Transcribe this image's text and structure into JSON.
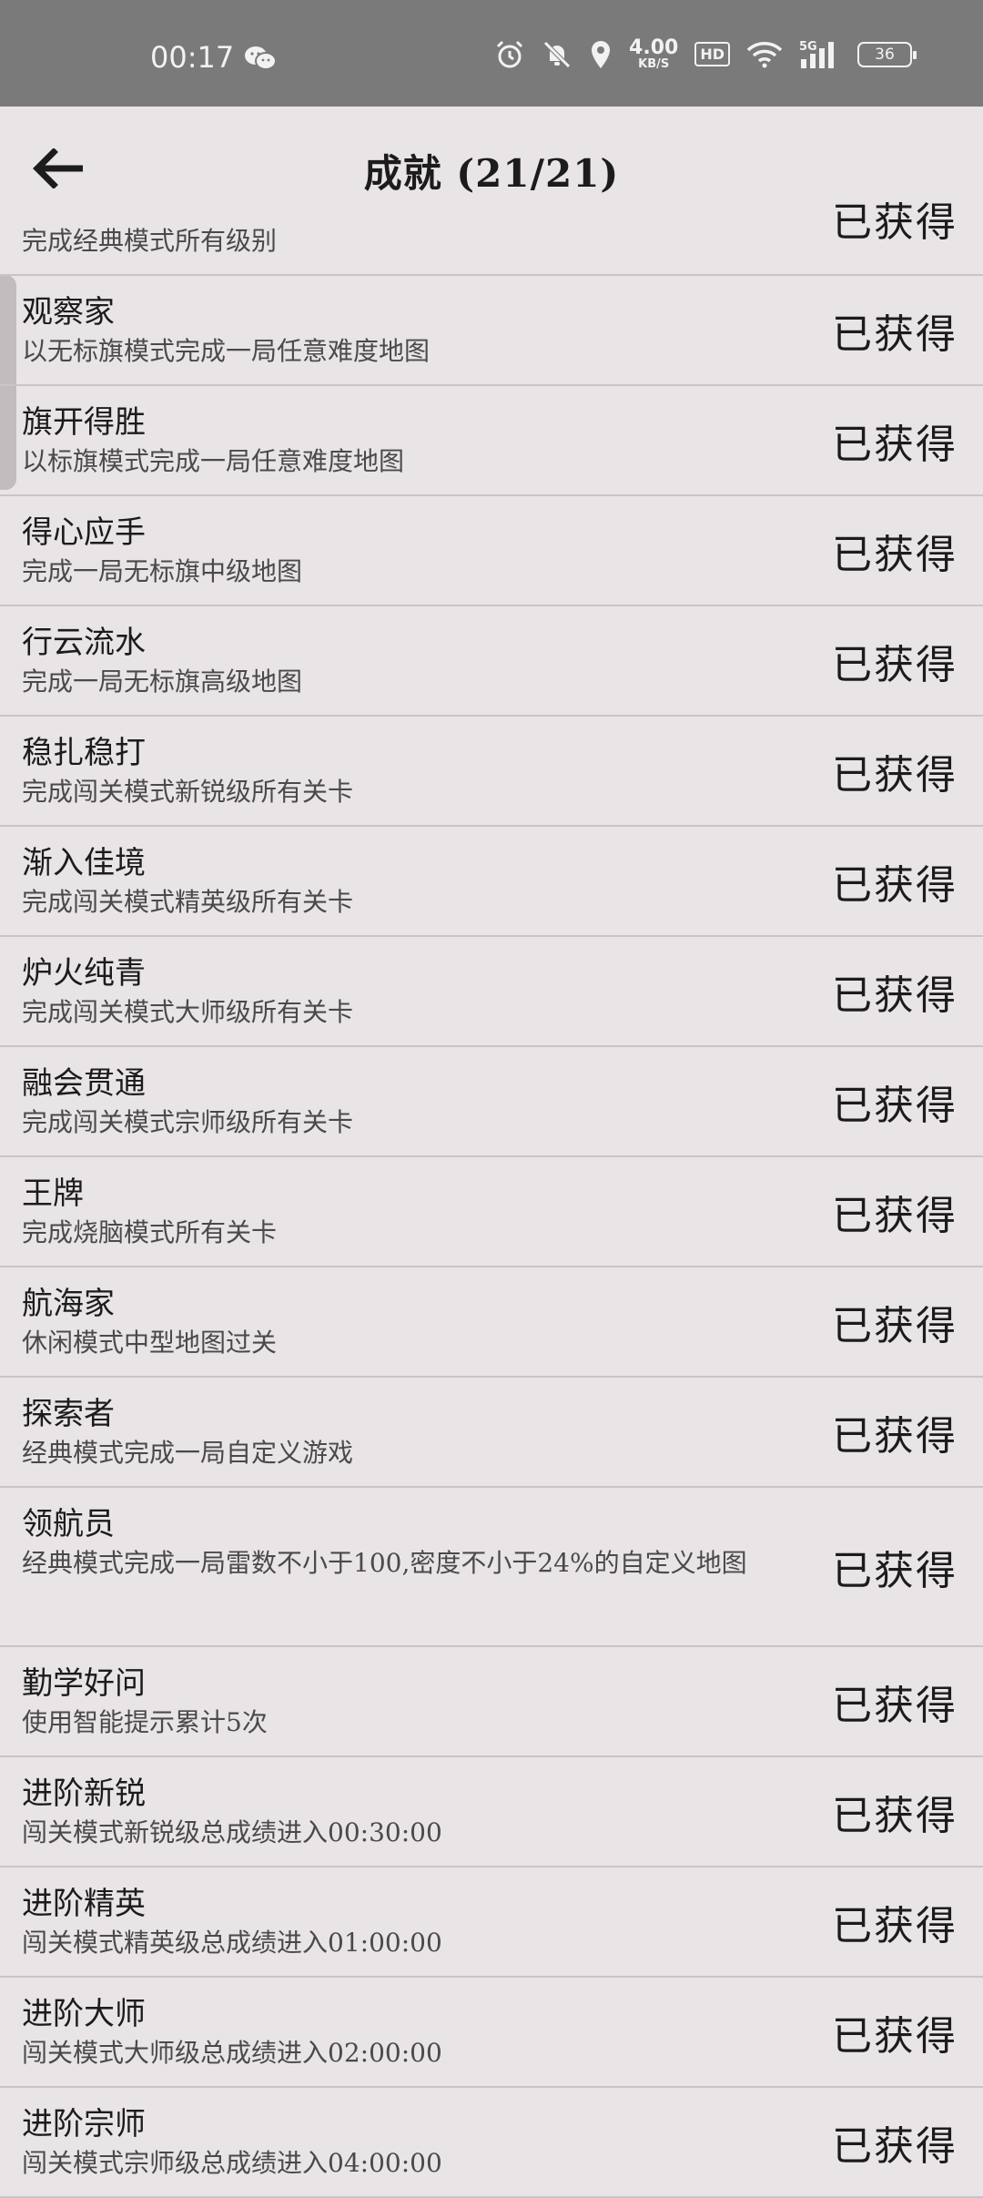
{
  "status_bar": {
    "time": "00:17",
    "net_speed_value": "4.00",
    "net_speed_unit": "KB/S",
    "hd_label": "HD",
    "signal_label": "5G",
    "battery": "36",
    "icons": [
      "wechat-icon",
      "alarm-icon",
      "mute-icon",
      "location-icon",
      "wifi-icon",
      "signal-icon",
      "battery-icon"
    ]
  },
  "header": {
    "title": "成就 (21/21)",
    "back_icon": "arrow-left-icon"
  },
  "achievements": [
    {
      "name": "",
      "desc": "完成经典模式所有级别",
      "status": "已获得"
    },
    {
      "name": "观察家",
      "desc": "以无标旗模式完成一局任意难度地图",
      "status": "已获得"
    },
    {
      "name": "旗开得胜",
      "desc": "以标旗模式完成一局任意难度地图",
      "status": "已获得"
    },
    {
      "name": "得心应手",
      "desc": "完成一局无标旗中级地图",
      "status": "已获得"
    },
    {
      "name": "行云流水",
      "desc": "完成一局无标旗高级地图",
      "status": "已获得"
    },
    {
      "name": "稳扎稳打",
      "desc": "完成闯关模式新锐级所有关卡",
      "status": "已获得"
    },
    {
      "name": "渐入佳境",
      "desc": "完成闯关模式精英级所有关卡",
      "status": "已获得"
    },
    {
      "name": "炉火纯青",
      "desc": "完成闯关模式大师级所有关卡",
      "status": "已获得"
    },
    {
      "name": "融会贯通",
      "desc": "完成闯关模式宗师级所有关卡",
      "status": "已获得"
    },
    {
      "name": "王牌",
      "desc": "完成烧脑模式所有关卡",
      "status": "已获得"
    },
    {
      "name": "航海家",
      "desc": "休闲模式中型地图过关",
      "status": "已获得"
    },
    {
      "name": "探索者",
      "desc": "经典模式完成一局自定义游戏",
      "status": "已获得"
    },
    {
      "name": "领航员",
      "desc": "经典模式完成一局雷数不小于100,密度不小于24%的自定义地图",
      "status": "已获得"
    },
    {
      "name": "勤学好问",
      "desc": "使用智能提示累计5次",
      "status": "已获得"
    },
    {
      "name": "进阶新锐",
      "desc": "闯关模式新锐级总成绩进入00:30:00",
      "status": "已获得"
    },
    {
      "name": "进阶精英",
      "desc": "闯关模式精英级总成绩进入01:00:00",
      "status": "已获得"
    },
    {
      "name": "进阶大师",
      "desc": "闯关模式大师级总成绩进入02:00:00",
      "status": "已获得"
    },
    {
      "name": "进阶宗师",
      "desc": "闯关模式宗师级总成绩进入04:00:00",
      "status": "已获得"
    }
  ]
}
